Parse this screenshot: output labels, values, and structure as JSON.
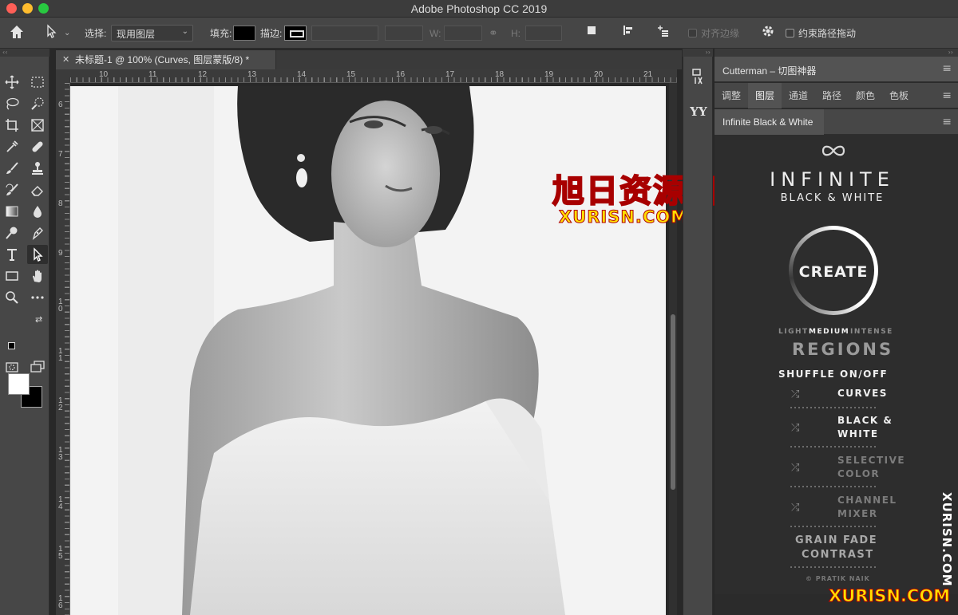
{
  "app": {
    "title": "Adobe Photoshop CC 2019"
  },
  "options": {
    "select_label": "选择:",
    "select_value": "现用图层",
    "fill_label": "填充:",
    "stroke_label": "描边:",
    "w_label": "W:",
    "h_label": "H:",
    "align_edges": "对齐边缘",
    "constrain_path": "约束路径拖动"
  },
  "document": {
    "tab_title": "未标题-1 @ 100% (Curves, 图层蒙版/8) *",
    "ruler_top": [
      "10",
      "11",
      "12",
      "13",
      "14",
      "15",
      "16",
      "17",
      "18",
      "19",
      "20",
      "21"
    ],
    "ruler_left": [
      "6",
      "7",
      "8",
      "9",
      "1\n0",
      "1\n1",
      "1\n2",
      "1\n3",
      "1\n4",
      "1\n5",
      "1\n6"
    ]
  },
  "watermark": {
    "main": "旭日资源网",
    "sub": "XURISN.COM",
    "side": "XURISN.COM",
    "bottom": "XURISN.COM"
  },
  "panels": {
    "cutterman_title": "Cutterman – 切图神器",
    "tabs": [
      "调整",
      "图层",
      "通道",
      "路径",
      "颜色",
      "色板"
    ],
    "active_tab": "图层",
    "plugin_tab": "Infinite Black & White"
  },
  "ibw": {
    "title_main": "INFINITE",
    "title_sub": "BLACK & WHITE",
    "create": "CREATE",
    "strength_light": "LIGHT",
    "strength_medium": "MEDIUM",
    "strength_intense": "INTENSE",
    "regions": "REGIONS",
    "shuffle": "SHUFFLE",
    "onoff": "ON/OFF",
    "rows": [
      {
        "label": "CURVES",
        "active": true
      },
      {
        "label": "BLACK & WHITE",
        "active": true
      },
      {
        "label": "SELECTIVE COLOR",
        "active": false
      },
      {
        "label": "CHANNEL MIXER",
        "active": false
      }
    ],
    "grain_fade": "GRAIN FADE",
    "contrast": "CONTRAST",
    "credit": "© PRATIK NAIK"
  },
  "colors": {
    "foreground": "#ffffff",
    "background": "#000000",
    "panel_bg": "#2d2d2d"
  }
}
